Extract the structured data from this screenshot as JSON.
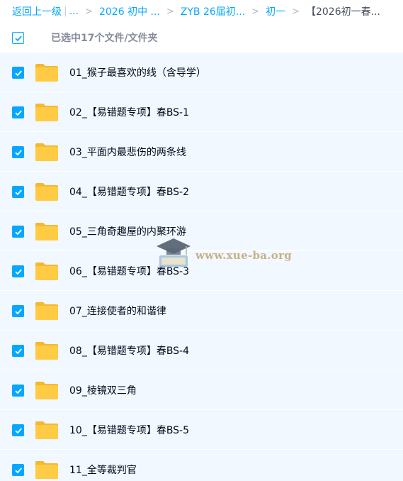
{
  "breadcrumb": {
    "back_label": "返回上一级",
    "ellipsis_label": "...",
    "crumbs": [
      "2026 初中 ...",
      "ZYB 26届初...",
      "初一"
    ],
    "current": "【2026初一春..."
  },
  "selection": {
    "text": "已选中17个文件/文件夹"
  },
  "files": [
    {
      "name": "01_猴子最喜欢的线（含导学）",
      "checked": true
    },
    {
      "name": "02_【易错题专项】春BS-1",
      "checked": true
    },
    {
      "name": "03_平面内最悲伤的两条线",
      "checked": true
    },
    {
      "name": "04_【易错题专项】春BS-2",
      "checked": true
    },
    {
      "name": "05_三角奇趣屋的内聚环游",
      "checked": true
    },
    {
      "name": "06_【易错题专项】春BS-3",
      "checked": true
    },
    {
      "name": "07_连接使者的和谐律",
      "checked": true
    },
    {
      "name": "08_【易错题专项】春BS-4",
      "checked": true
    },
    {
      "name": "09_棱镜双三角",
      "checked": true
    },
    {
      "name": "10_【易错题专项】春BS-5",
      "checked": true
    },
    {
      "name": "11_全等裁判官",
      "checked": true
    }
  ],
  "watermark": {
    "text": "www.xue-ba.org",
    "icon": "graduation-cap-book-logo"
  },
  "colors": {
    "accent": "#06a7ff",
    "row_bg": "#f1f8ff",
    "folder": "#ffc83d"
  }
}
